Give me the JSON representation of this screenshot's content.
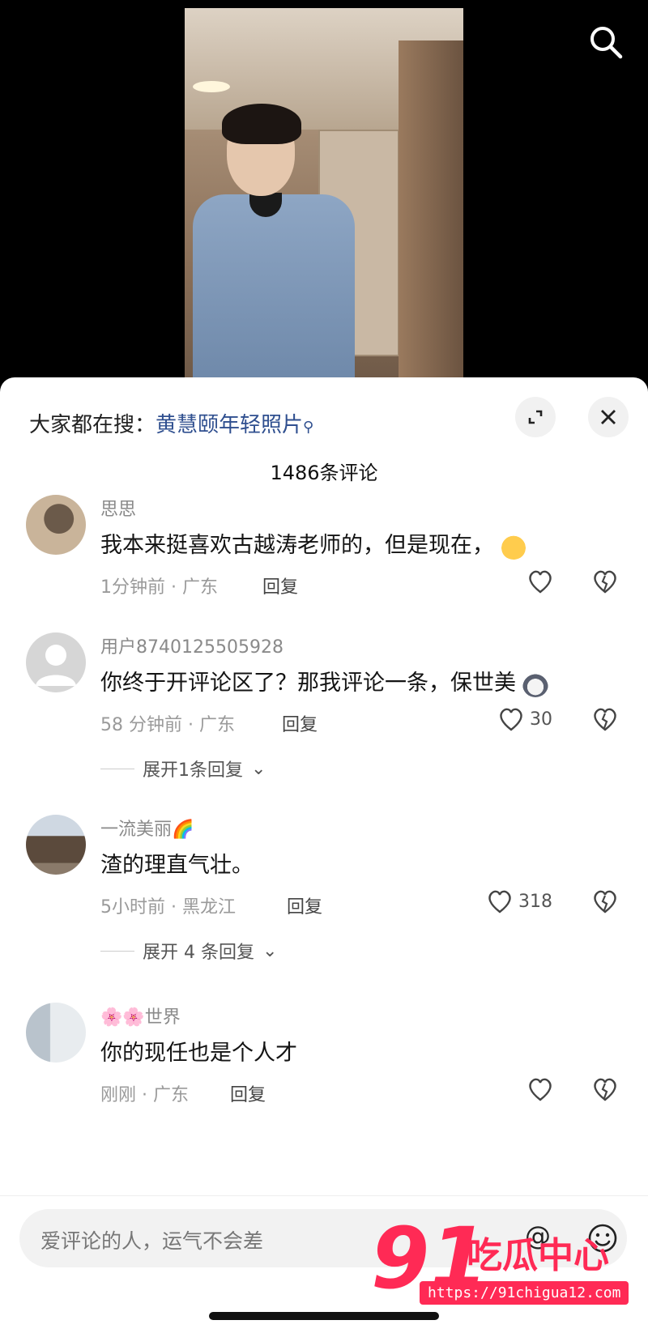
{
  "header": {
    "hot_search_prefix": "大家都在搜：",
    "hot_search_keyword": "黄慧颐年轻照片",
    "comment_count": "1486条评论"
  },
  "comments": [
    {
      "username": "思思",
      "text": "我本来挺喜欢古越涛老师的，但是现在，",
      "emoji": "sweat-face-emoji",
      "time": "1分钟前 · 广东",
      "reply_label": "回复",
      "likes": ""
    },
    {
      "username": "用户8740125505928",
      "text": "你终于开评论区了？那我评论一条，保世美",
      "emoji": "husky-face-emoji",
      "time": "58 分钟前 · 广东",
      "reply_label": "回复",
      "likes": "30",
      "expand_label": "展开1条回复"
    },
    {
      "username": "一流美丽🌈",
      "text": "渣的理直气壮。",
      "time": "5小时前 · 黑龙江",
      "reply_label": "回复",
      "likes": "318",
      "expand_label": "展开 4 条回复"
    },
    {
      "username": "🌸🌸世界",
      "text": "你的现任也是个人才",
      "time": "刚刚 · 广东",
      "reply_label": "回复",
      "likes": ""
    }
  ],
  "input": {
    "placeholder": "爱评论的人，运气不会差",
    "at_symbol": "@"
  },
  "watermark": {
    "number": "91",
    "name": "吃瓜中心",
    "url": "https://91chigua12.com"
  },
  "colors": {
    "keyword": "#2f4f8f",
    "watermark": "#ff2a55"
  }
}
